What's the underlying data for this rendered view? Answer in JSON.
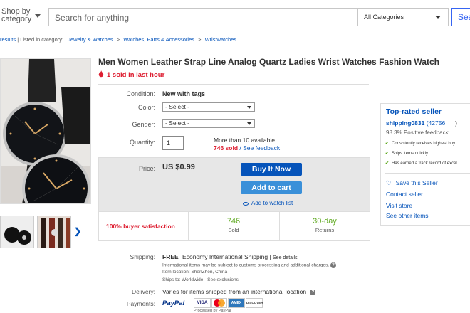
{
  "header": {
    "shop_by_category": "Shop by category",
    "search_placeholder": "Search for anything",
    "category_select": "All Categories",
    "search_button": "Sea"
  },
  "breadcrumb": {
    "back": "results",
    "listed_in": "| Listed in category:",
    "path": [
      "Jewelry & Watches",
      "Watches, Parts & Accessories",
      "Wristwatches"
    ],
    "separator": ">"
  },
  "listing": {
    "title": "Men Women Leather Strap Line Analog Quartz Ladies Wrist Watches Fashion Watch",
    "sold_recently": "1 sold in last hour",
    "condition_label": "Condition:",
    "condition_value": "New with tags",
    "color_label": "Color:",
    "color_value": "- Select -",
    "gender_label": "Gender:",
    "gender_value": "- Select -",
    "quantity_label": "Quantity:",
    "quantity_value": "1",
    "available": "More than 10 available",
    "sold_count": "746 sold",
    "feedback_sep": " / ",
    "see_feedback": "See feedback",
    "price_label": "Price:",
    "price": "US $0.99",
    "buy_now": "Buy It Now",
    "add_to_cart": "Add to cart",
    "add_to_watch": "Add to watch list"
  },
  "stats": {
    "satisfaction": "100% buyer satisfaction",
    "sold_value": "746",
    "sold_label": "Sold",
    "returns_value": "30-day",
    "returns_label": "Returns"
  },
  "seller": {
    "heading": "Top-rated seller",
    "name": "shipping0831",
    "score": "(42756",
    "score_end": ")",
    "positive": "98.3% Positive feedback",
    "badges": [
      "Consistently receives highest buy",
      "Ships items quickly",
      "Has earned a track record of excel"
    ],
    "save": "Save this Seller",
    "contact": "Contact seller",
    "visit": "Visit store",
    "other": "See other items"
  },
  "shipping": {
    "shipping_label": "Shipping:",
    "free": "FREE",
    "method": "Economy International Shipping |",
    "see_details": "See details",
    "customs_note": "International items may be subject to customs processing and additional charges.",
    "location": "Item location:  ShenZhen, China",
    "ships_to_prefix": "Ships to:  Worldwide",
    "see_exclusions": "See exclusions",
    "delivery_label": "Delivery:",
    "delivery_value": "Varies for items shipped from an international location",
    "payments_label": "Payments:",
    "paypal": "PayPal",
    "logos": [
      "VISA",
      "MC",
      "AMEX",
      "DISCOVER"
    ],
    "processed_by": "Processed by PayPal"
  },
  "colors": {
    "link": "#0654ba",
    "red": "#dd1e31",
    "green": "#5ba71b",
    "buy_now_bg": "#0654ba",
    "cart_bg": "#3a90d9"
  }
}
